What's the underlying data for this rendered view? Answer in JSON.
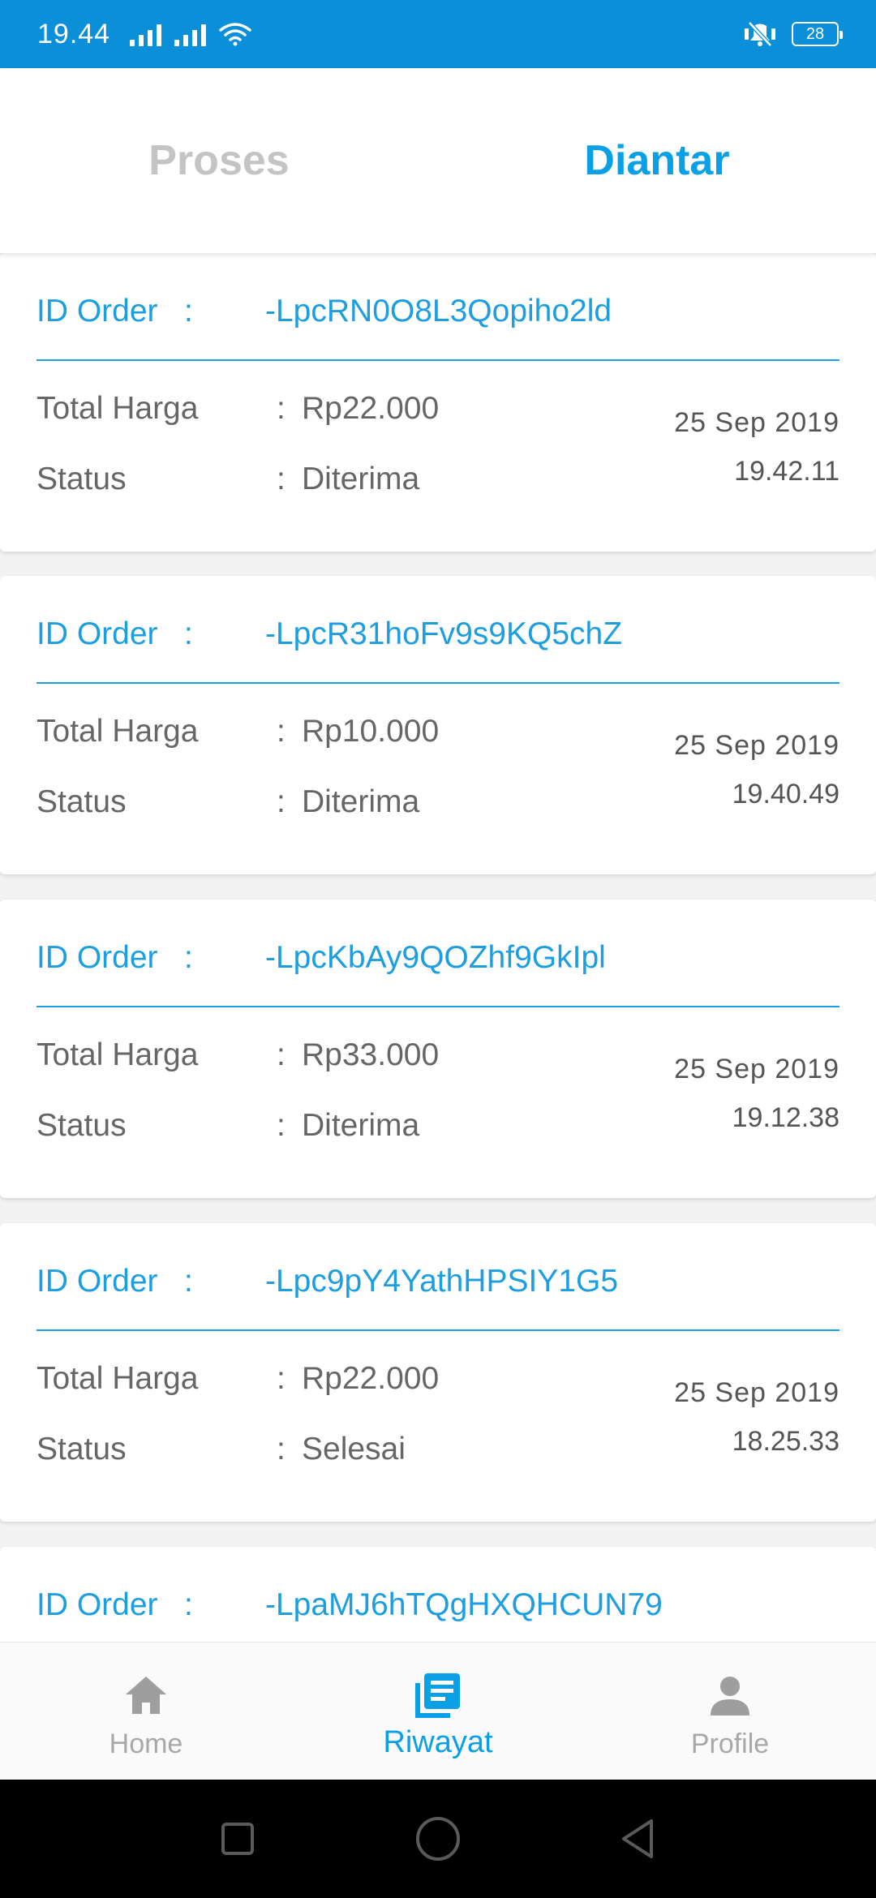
{
  "status_bar": {
    "time": "19.44",
    "battery": "28",
    "icons": [
      "signal-icon",
      "signal-icon",
      "wifi-icon",
      "mute-icon",
      "battery-icon"
    ]
  },
  "tabs": [
    {
      "label": "Proses",
      "active": false
    },
    {
      "label": "Diantar",
      "active": true
    }
  ],
  "labels": {
    "id_order": "ID Order",
    "id_colon": ":",
    "total_harga": "Total Harga",
    "status": "Status",
    "colon": ":"
  },
  "orders": [
    {
      "id": "-LpcRN0O8L3Qopiho2ld",
      "total": "Rp22.000",
      "status": "Diterima",
      "date": "25  Sep  2019",
      "time": "19.42.11"
    },
    {
      "id": "-LpcR31hoFv9s9KQ5chZ",
      "total": "Rp10.000",
      "status": "Diterima",
      "date": "25  Sep  2019",
      "time": "19.40.49"
    },
    {
      "id": "-LpcKbAy9QOZhf9GkIpl",
      "total": "Rp33.000",
      "status": "Diterima",
      "date": "25  Sep  2019",
      "time": "19.12.38"
    },
    {
      "id": "-Lpc9pY4YathHPSIY1G5",
      "total": "Rp22.000",
      "status": "Selesai",
      "date": "25  Sep  2019",
      "time": "18.25.33"
    },
    {
      "id": "-LpaMJ6hTQgHXQHCUN79"
    }
  ],
  "bottom_nav": [
    {
      "label": "Home",
      "icon": "home-icon",
      "active": false
    },
    {
      "label": "Riwayat",
      "icon": "history-icon",
      "active": true
    },
    {
      "label": "Profile",
      "icon": "profile-icon",
      "active": false
    }
  ],
  "colors": {
    "status_bar": "#0a8fd8",
    "accent": "#0aa0e6",
    "inactive": "#c4c4c4",
    "text": "#666666"
  }
}
